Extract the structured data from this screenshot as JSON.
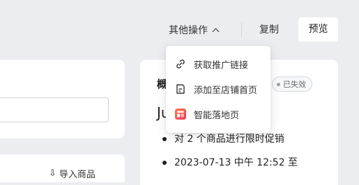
{
  "topbar": {
    "more_actions_label": "其他操作",
    "copy_label": "复制",
    "preview_label": "预览"
  },
  "dropdown": {
    "items": [
      {
        "label": "获取推广链接",
        "icon": "link-icon"
      },
      {
        "label": "添加至店铺首页",
        "icon": "page-icon"
      },
      {
        "label": "智能落地页",
        "icon": "landing-page-icon"
      }
    ]
  },
  "left_panel": {
    "import_label": "导入商品"
  },
  "summary": {
    "title": "概",
    "status": "已失效",
    "name": "Ju",
    "bullets": [
      "对 2 个商品进行限时促销",
      "2023-07-13 中午 12:52 至"
    ]
  },
  "colors": {
    "background": "#ecedf0",
    "card": "#ffffff",
    "landing_icon": "#f25a4a"
  }
}
